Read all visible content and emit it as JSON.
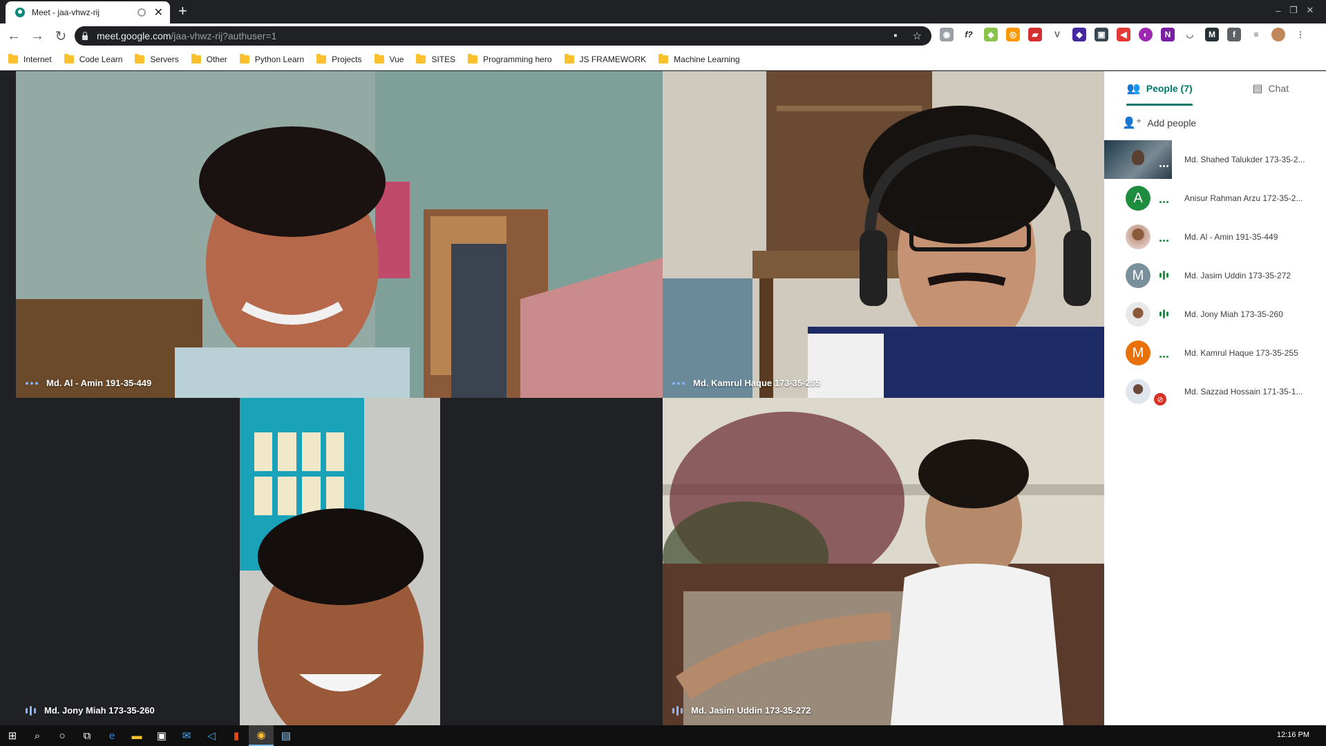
{
  "browser": {
    "tab_title": "Meet - jaa-vhwz-rij",
    "new_tab_symbol": "+",
    "url_host": "meet.google.com",
    "url_path": "/jaa-vhwz-rij?authuser=1",
    "window_controls": [
      "–",
      "❐",
      "✕"
    ]
  },
  "bookmarks": [
    "Internet",
    "Code Learn",
    "Servers",
    "Other",
    "Python Learn",
    "Projects",
    "Vue",
    "SITES",
    "Programming hero",
    "JS FRAMEWORK",
    "Machine Learning"
  ],
  "tiles": [
    {
      "name": "Md. Al - Amin 191-35-449",
      "status": "dots"
    },
    {
      "name": "Md. Kamrul Haque 173-35-255",
      "status": "dots"
    },
    {
      "name": "Md. Jony Miah 173-35-260",
      "status": "bars"
    },
    {
      "name": "Md. Jasim Uddin 173-35-272",
      "status": "bars"
    }
  ],
  "panel": {
    "people_tab": "People (7)",
    "chat_tab": "Chat",
    "add_people": "Add people",
    "participants": [
      {
        "name": "Md. Shahed Talukder 173-35-2...",
        "avatar": "thumb",
        "status": "dots"
      },
      {
        "name": "Anisur Rahman Arzu 172-35-2...",
        "avatar": "A",
        "avatar_color": "#1e8e3e",
        "status": "dots"
      },
      {
        "name": "Md. Al - Amin 191-35-449",
        "avatar": "photo",
        "status": "dots"
      },
      {
        "name": "Md. Jasim Uddin 173-35-272",
        "avatar": "M",
        "avatar_color": "#78909c",
        "status": "bars"
      },
      {
        "name": "Md. Jony Miah 173-35-260",
        "avatar": "photo",
        "status": "bars"
      },
      {
        "name": "Md. Kamrul Haque 173-35-255",
        "avatar": "M",
        "avatar_color": "#e8710a",
        "status": "dots"
      },
      {
        "name": "Md. Sazzad Hossain 171-35-1...",
        "avatar": "photo",
        "status": "muted"
      }
    ]
  },
  "taskbar": {
    "clock": "12:16 PM"
  }
}
